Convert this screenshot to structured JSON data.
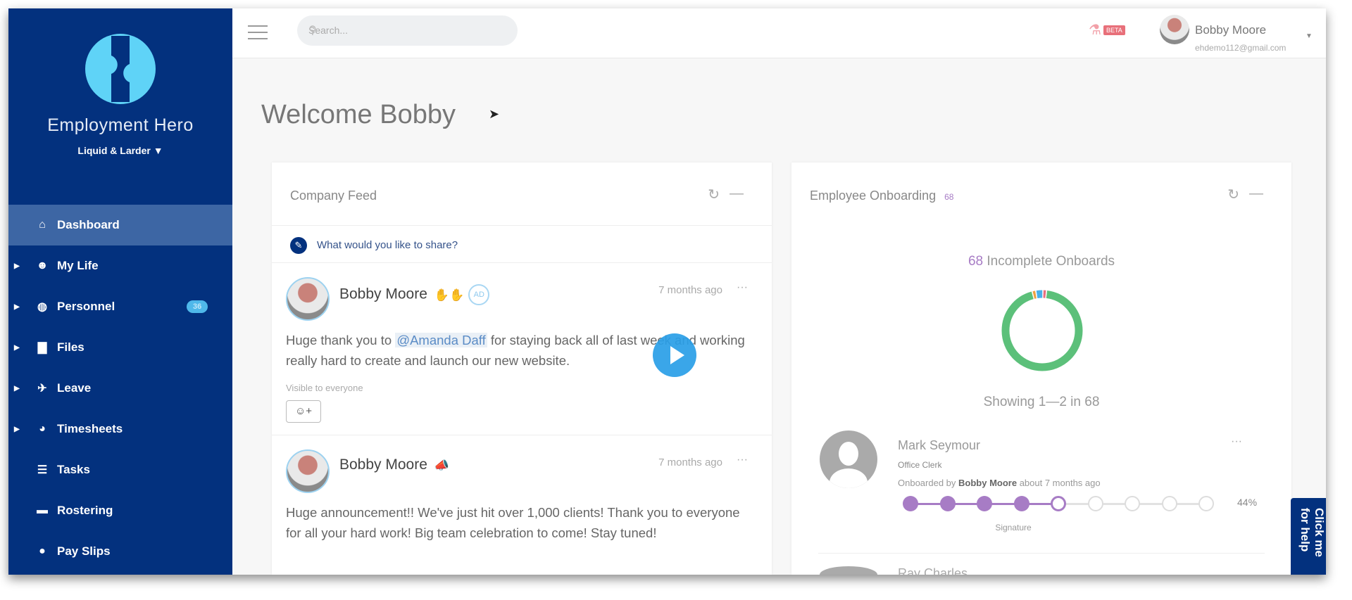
{
  "brand": {
    "name": "Employment Hero",
    "org": "Liquid & Larder",
    "logo_color": "#5fd3f7",
    "sidebar_color": "#03317e"
  },
  "sidebar": {
    "items": [
      {
        "label": "Dashboard",
        "icon": "home-icon",
        "active": true,
        "expandable": false
      },
      {
        "label": "My Life",
        "icon": "smiley-icon",
        "expandable": true
      },
      {
        "label": "Personnel",
        "icon": "globe-icon",
        "expandable": true,
        "badge": "36"
      },
      {
        "label": "Files",
        "icon": "folder-icon",
        "expandable": true
      },
      {
        "label": "Leave",
        "icon": "plane-icon",
        "expandable": true
      },
      {
        "label": "Timesheets",
        "icon": "stopwatch-icon",
        "expandable": true
      },
      {
        "label": "Tasks",
        "icon": "list-icon",
        "expandable": false
      },
      {
        "label": "Rostering",
        "icon": "calendar-icon",
        "expandable": false
      },
      {
        "label": "Pay Slips",
        "icon": "dollar-icon",
        "expandable": false
      }
    ]
  },
  "header": {
    "search_placeholder": "Search...",
    "beta_label": "BETA",
    "user_name": "Bobby Moore",
    "user_email": "ehdemo112@gmail.com"
  },
  "page": {
    "title": "Welcome Bobby"
  },
  "feed": {
    "title": "Company Feed",
    "share_prompt": "What would you like to share?",
    "posts": [
      {
        "author": "Bobby Moore",
        "time": "7 months ago",
        "badge": "AD",
        "pre": "Huge thank you to ",
        "mention": "@Amanda Daff",
        "post": " for staying back all of last week and working really hard to create and launch our new website.",
        "visibility": "Visible to everyone"
      },
      {
        "author": "Bobby Moore",
        "time": "7 months ago",
        "body": "Huge announcement!! We've just hit over 1,000 clients! Thank you to everyone for all your hard work! Big team celebration to come! Stay tuned!"
      }
    ]
  },
  "onboarding": {
    "title": "Employee Onboarding",
    "count": "68",
    "incomplete_count": "68",
    "incomplete_label": "Incomplete Onboards",
    "showing": "Showing 1—2 in  68",
    "donut": [
      {
        "value": 64,
        "color": "#5cc07a"
      },
      {
        "value": 1,
        "color": "#f0a040"
      },
      {
        "value": 2,
        "color": "#4ab0ea"
      },
      {
        "value": 1,
        "color": "#e87080"
      }
    ],
    "employees": [
      {
        "name": "Mark Seymour",
        "role": "Office Clerk",
        "by_pre": "Onboarded by ",
        "by_name": "Bobby Moore",
        "by_post": " about 7 months ago",
        "progress_pct": "44%",
        "steps_total": 9,
        "steps_done": 4,
        "current_step_label": "Signature"
      },
      {
        "name": "Ray Charles"
      }
    ]
  },
  "help_tab": "Click me for help"
}
